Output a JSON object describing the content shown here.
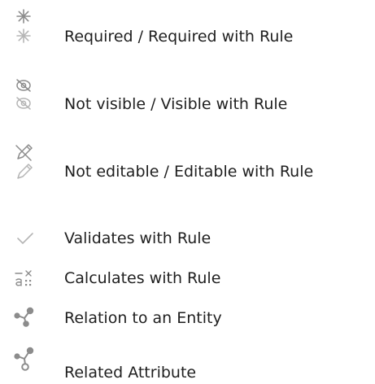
{
  "legend": {
    "items": [
      {
        "id": "required",
        "icon": "required-asterisk-icon",
        "label": "Required / Required with Rule"
      },
      {
        "id": "visible",
        "icon": "eye-visibility-icon",
        "label": "Not visible / Visible with Rule"
      },
      {
        "id": "editable",
        "icon": "pencil-edit-icon",
        "label": "Not editable / Editable with Rule"
      },
      {
        "id": "validates",
        "icon": "checkmark-icon",
        "label": "Validates with Rule"
      },
      {
        "id": "calculates",
        "icon": "calculator-formula-icon",
        "label": "Calculates with Rule"
      },
      {
        "id": "relation",
        "icon": "relation-nodes-icon",
        "label": "Relation to an Entity"
      },
      {
        "id": "related",
        "icon": "related-attribute-nodes-icon",
        "label": "Related Attribute"
      }
    ]
  },
  "colors": {
    "text": "#1f1f1f",
    "icon_dark": "#8c8c8c",
    "icon_light": "#b5b5b5"
  }
}
